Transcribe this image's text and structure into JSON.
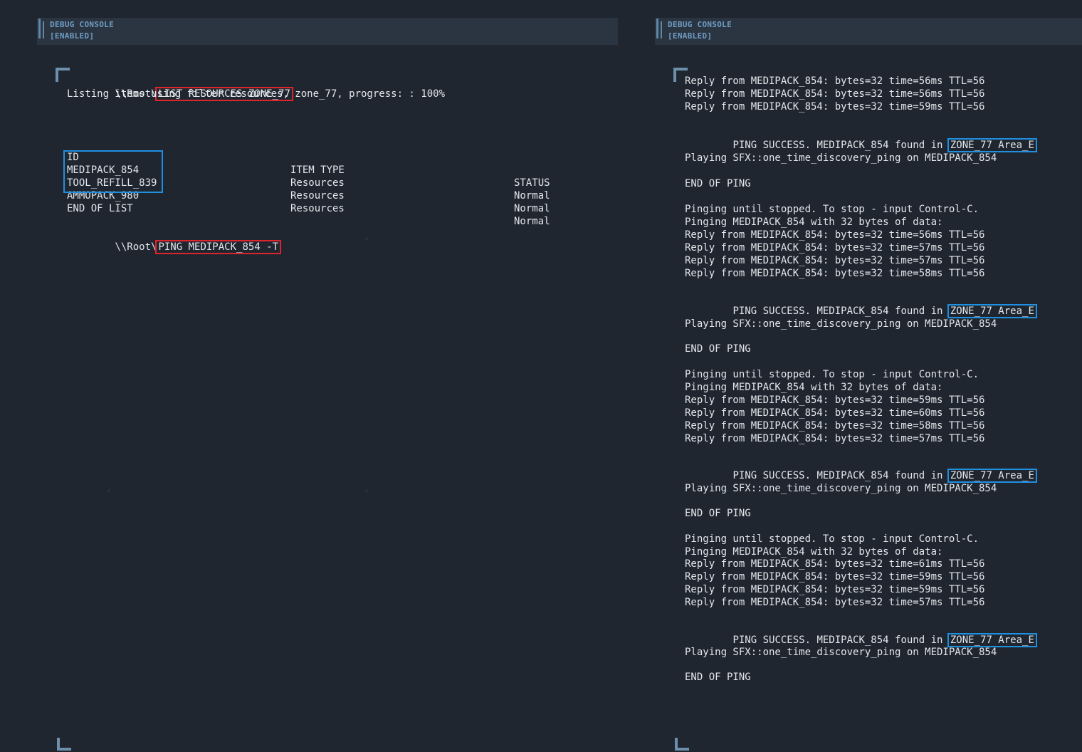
{
  "left_console": {
    "header": {
      "title": "DEBUG CONSOLE",
      "status": "[ENABLED]"
    },
    "cmd1": {
      "prompt": "\\\\Root\\",
      "command": "LIST RESOURCES ZONE_77"
    },
    "listing_line": "Listing items using filter resources, zone_77, progress: : 100%",
    "table": {
      "headers": [
        "ID",
        "ITEM TYPE",
        "STATUS"
      ],
      "rows": [
        {
          "id": "MEDIPACK_854",
          "type": "Resources",
          "status": "Normal"
        },
        {
          "id": "TOOL_REFILL_839",
          "type": "Resources",
          "status": "Normal"
        },
        {
          "id": "AMMOPACK_980",
          "type": "Resources",
          "status": "Normal"
        }
      ]
    },
    "end_of_list": "END OF LIST",
    "cmd2": {
      "prompt": "\\\\Root\\",
      "command": "PING MEDIPACK_854 -T"
    }
  },
  "right_console": {
    "header": {
      "title": "DEBUG CONSOLE",
      "status": "[ENABLED]"
    },
    "replies_top": [
      "Reply from MEDIPACK_854: bytes=32 time=56ms TTL=56",
      "Reply from MEDIPACK_854: bytes=32 time=56ms TTL=56",
      "Reply from MEDIPACK_854: bytes=32 time=59ms TTL=56"
    ],
    "ping_success_prefix": "PING SUCCESS. MEDIPACK_854 found in ",
    "location": "ZONE_77 Area_E",
    "playing_sfx": "Playing SFX::one_time_discovery_ping on MEDIPACK_854",
    "end_of_ping": "END OF PING",
    "pinging_until": "Pinging until stopped. To stop - input Control-C.",
    "pinging_with": "Pinging MEDIPACK_854 with 32 bytes of data:",
    "blocks": [
      {
        "replies": [
          "Reply from MEDIPACK_854: bytes=32 time=56ms TTL=56",
          "Reply from MEDIPACK_854: bytes=32 time=57ms TTL=56",
          "Reply from MEDIPACK_854: bytes=32 time=57ms TTL=56",
          "Reply from MEDIPACK_854: bytes=32 time=58ms TTL=56"
        ]
      },
      {
        "replies": [
          "Reply from MEDIPACK_854: bytes=32 time=59ms TTL=56",
          "Reply from MEDIPACK_854: bytes=32 time=60ms TTL=56",
          "Reply from MEDIPACK_854: bytes=32 time=58ms TTL=56",
          "Reply from MEDIPACK_854: bytes=32 time=57ms TTL=56"
        ]
      },
      {
        "replies": [
          "Reply from MEDIPACK_854: bytes=32 time=61ms TTL=56",
          "Reply from MEDIPACK_854: bytes=32 time=59ms TTL=56",
          "Reply from MEDIPACK_854: bytes=32 time=59ms TTL=56",
          "Reply from MEDIPACK_854: bytes=32 time=57ms TTL=56"
        ]
      }
    ]
  }
}
